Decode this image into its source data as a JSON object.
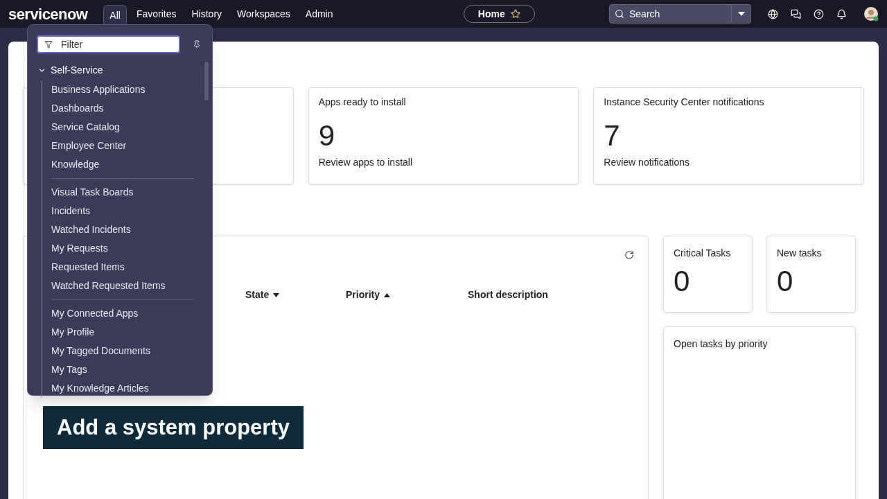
{
  "top_bar": {
    "logo": "servicenow",
    "nav": [
      {
        "label": "All",
        "selected": true
      },
      {
        "label": "Favorites",
        "selected": false
      },
      {
        "label": "History",
        "selected": false
      },
      {
        "label": "Workspaces",
        "selected": false
      },
      {
        "label": "Admin",
        "selected": false
      }
    ],
    "home_tab": "Home",
    "search": {
      "placeholder": "Search"
    }
  },
  "menu": {
    "filter": {
      "placeholder": "Filter"
    },
    "section": {
      "label": "Self-Service",
      "expanded": true,
      "groups": [
        [
          "Business Applications",
          "Dashboards",
          "Service Catalog",
          "Employee Center",
          "Knowledge"
        ],
        [
          "Visual Task Boards",
          "Incidents",
          "Watched Incidents",
          "My Requests",
          "Requested Items",
          "Watched Requested Items"
        ],
        [
          "My Connected Apps",
          "My Profile",
          "My Tagged Documents",
          "My Tags",
          "My Knowledge Articles"
        ]
      ]
    }
  },
  "cards": [
    {
      "title": "Apps ready to install",
      "value": "9",
      "link": "Review apps to install"
    },
    {
      "title": "Instance Security Center notifications",
      "value": "7",
      "link": "Review notifications"
    }
  ],
  "task_table": {
    "columns": [
      {
        "label": "State",
        "sorted_ascending": false,
        "sorted_descending": true
      },
      {
        "label": "Priority",
        "sorted_ascending": true,
        "sorted_descending": false
      },
      {
        "label": "Short description",
        "sorted_ascending": false,
        "sorted_descending": false
      }
    ]
  },
  "task_counts": [
    {
      "title": "Critical Tasks",
      "value": "0"
    },
    {
      "title": "New tasks",
      "value": "0"
    }
  ],
  "priority_panel": {
    "title": "Open tasks by priority"
  },
  "caption": "Add a system property"
}
